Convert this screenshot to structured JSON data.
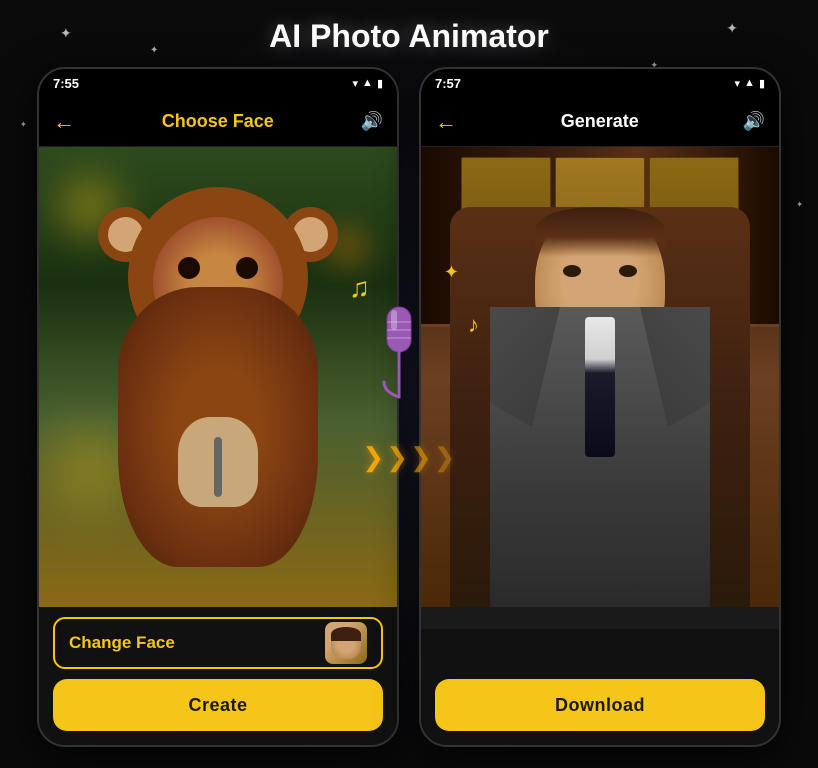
{
  "page": {
    "title": "AI Photo Animator",
    "background_color": "#0a0a0a"
  },
  "left_phone": {
    "status_time": "7:55",
    "nav_title": "Choose Face",
    "nav_title_color": "yellow",
    "change_face_label": "Change Face",
    "create_label": "Create"
  },
  "right_phone": {
    "status_time": "7:57",
    "nav_title": "Generate",
    "nav_title_color": "white",
    "download_label": "Download"
  },
  "icons": {
    "back_arrow": "←",
    "sound": "🔊",
    "music_note": "♪",
    "music_note2": "♫",
    "sparkle": "✦",
    "arrows": "❯❯❯"
  }
}
